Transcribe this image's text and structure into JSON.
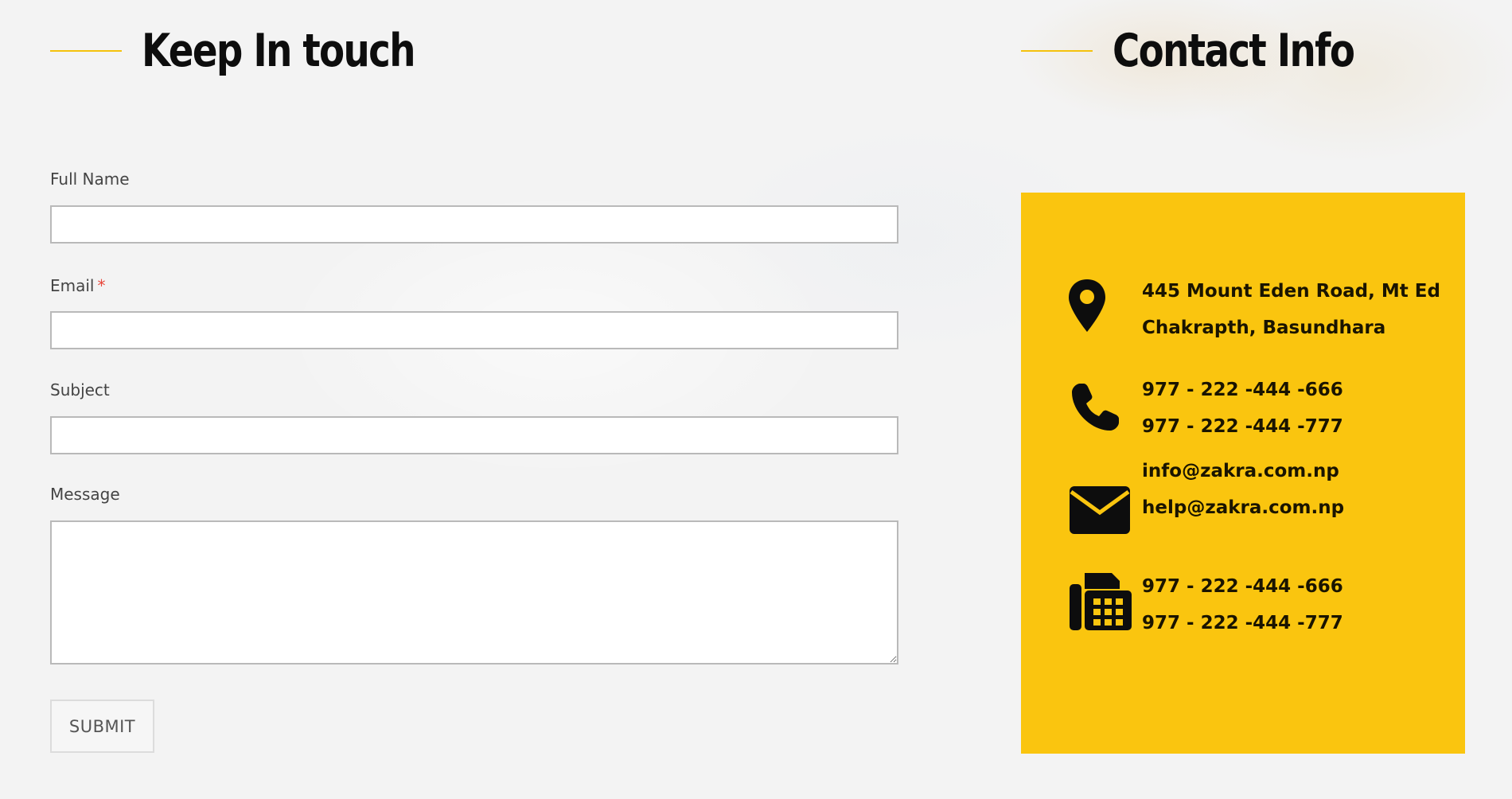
{
  "left_heading": "Keep In touch",
  "right_heading": "Contact Info",
  "form": {
    "full_name_label": "Full Name",
    "full_name_value": "",
    "email_label": "Email",
    "email_required_marker": "*",
    "email_value": "",
    "subject_label": "Subject",
    "subject_value": "",
    "message_label": "Message",
    "message_value": "",
    "submit_label": "SUBMIT"
  },
  "contact": {
    "address": {
      "icon": "map-pin-icon",
      "line1": "445 Mount Eden Road, Mt Ed",
      "line2": "Chakrapth, Basundhara"
    },
    "phone": {
      "icon": "phone-icon",
      "line1": "977 - 222 -444 -666",
      "line2": "977 - 222 -444 -777"
    },
    "email": {
      "icon": "envelope-icon",
      "line1": "info@zakra.com.np",
      "line2": "help@zakra.com.np"
    },
    "fax": {
      "icon": "fax-icon",
      "line1": "977 - 222 -444 -666",
      "line2": "977 - 222 -444 -777"
    }
  },
  "colors": {
    "accent": "#fac50f",
    "heading_line": "#f4c20d",
    "required": "#e8463a",
    "text_dark": "#0d0d0d"
  }
}
